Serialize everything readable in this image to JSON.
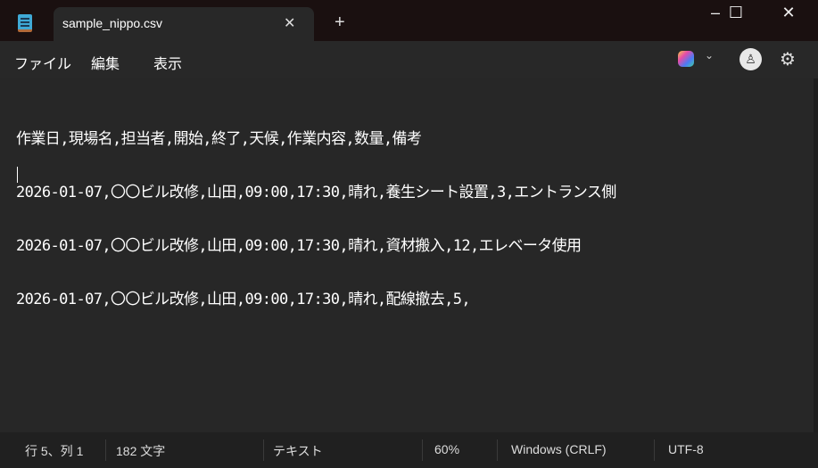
{
  "window": {
    "tab_title": "sample_nippo.csv",
    "new_tab": "+",
    "close_tab": "✕",
    "minimize": "–",
    "maximize": "☐",
    "close": "✕"
  },
  "menu": {
    "items": [
      "ファイル",
      "編集",
      "表示"
    ],
    "copilot_chevron": "⌄",
    "avatar": "♙",
    "settings": "⚙"
  },
  "editor": {
    "lines": [
      "作業日,現場名,担当者,開始,終了,天候,作業内容,数量,備考",
      "2026-01-07,〇〇ビル改修,山田,09:00,17:30,晴れ,養生シート設置,3,エントランス側",
      "2026-01-07,〇〇ビル改修,山田,09:00,17:30,晴れ,資材搬入,12,エレベータ使用",
      "2026-01-07,〇〇ビル改修,山田,09:00,17:30,晴れ,配線撤去,5,"
    ]
  },
  "status": {
    "position": "行 5、列 1",
    "chars": "182 文字",
    "type": "テキスト",
    "zoom": "60%",
    "line_ending": "Windows (CRLF)",
    "encoding": "UTF-8"
  }
}
